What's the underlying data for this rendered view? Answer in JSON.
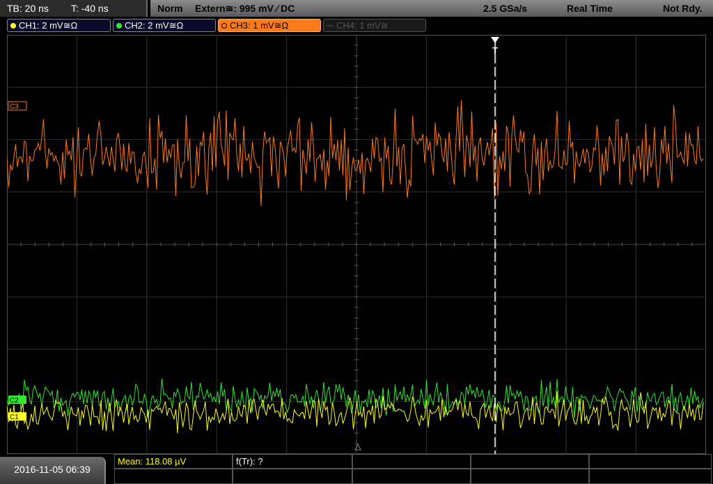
{
  "top": {
    "tb": "TB: 20 ns",
    "trigger_pos": "T: -40 ns",
    "mode": "Norm",
    "source": "Extern≅: 995 mV ⁄ DC",
    "sample_rate": "2.5 GSa/s",
    "acq": "Real Time",
    "status": "Not Rdy."
  },
  "channels": [
    {
      "label": "CH1: 2 mV≅Ω",
      "color": "#ffff20"
    },
    {
      "label": "CH2: 2 mV≅Ω",
      "color": "#30e830"
    },
    {
      "label": "CH3: 1 mV≅Ω",
      "color": "#ff7a1a"
    },
    {
      "label": "CH4: 1 mV≅",
      "color": "#555555"
    }
  ],
  "markers": {
    "c3": "C3",
    "c2": "C2",
    "c1": "C1",
    "trigger": "T"
  },
  "bottom": {
    "datetime": "2016-11-05 06:39",
    "mean": "Mean: 118.08 µV",
    "ftr": "f(Tr): ?"
  },
  "colors": {
    "grid": "#3a3a3a",
    "ch1": "#ffff20",
    "ch2": "#30e830",
    "ch3": "#ff7a1a"
  }
}
